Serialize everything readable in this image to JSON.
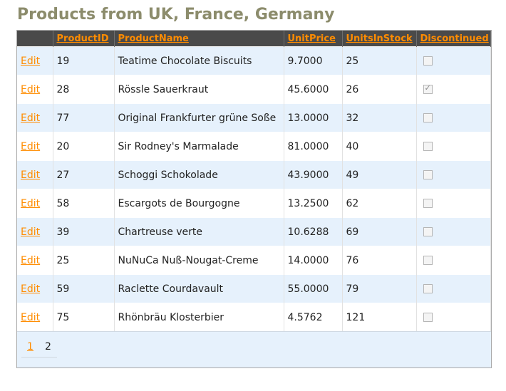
{
  "title": "Products from UK, France, Germany",
  "columns": [
    "",
    "ProductID",
    "ProductName",
    "UnitPrice",
    "UnitsInStock",
    "Discontinued"
  ],
  "edit_label": "Edit",
  "rows": [
    {
      "id": "19",
      "name": "Teatime Chocolate Biscuits",
      "price": "9.7000",
      "stock": "25",
      "discontinued": false
    },
    {
      "id": "28",
      "name": "Rössle Sauerkraut",
      "price": "45.6000",
      "stock": "26",
      "discontinued": true
    },
    {
      "id": "77",
      "name": "Original Frankfurter grüne Soße",
      "price": "13.0000",
      "stock": "32",
      "discontinued": false
    },
    {
      "id": "20",
      "name": "Sir Rodney's Marmalade",
      "price": "81.0000",
      "stock": "40",
      "discontinued": false
    },
    {
      "id": "27",
      "name": "Schoggi Schokolade",
      "price": "43.9000",
      "stock": "49",
      "discontinued": false
    },
    {
      "id": "58",
      "name": "Escargots de Bourgogne",
      "price": "13.2500",
      "stock": "62",
      "discontinued": false
    },
    {
      "id": "39",
      "name": "Chartreuse verte",
      "price": "10.6288",
      "stock": "69",
      "discontinued": false
    },
    {
      "id": "25",
      "name": "NuNuCa Nuß-Nougat-Creme",
      "price": "14.0000",
      "stock": "76",
      "discontinued": false
    },
    {
      "id": "59",
      "name": "Raclette Courdavault",
      "price": "55.0000",
      "stock": "79",
      "discontinued": false
    },
    {
      "id": "75",
      "name": "Rhönbräu Klosterbier",
      "price": "4.5762",
      "stock": "121",
      "discontinued": false
    }
  ],
  "pager": {
    "pages": [
      "1",
      "2"
    ],
    "current": "2"
  },
  "colors": {
    "title": "#8c8c6c",
    "header_bg": "#4a4a4a",
    "link": "#ff8c00",
    "alt_row": "#e6f1fc"
  }
}
